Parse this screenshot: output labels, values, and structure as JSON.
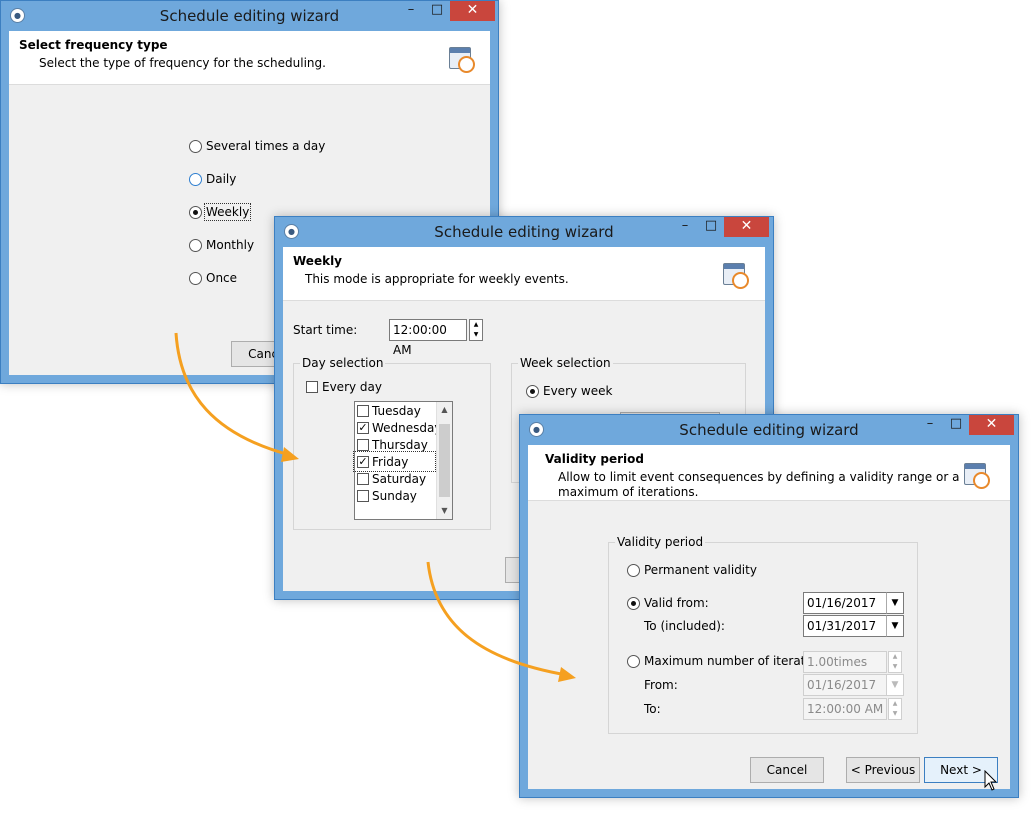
{
  "win1": {
    "title": "Schedule editing wizard",
    "header_title": "Select frequency type",
    "header_sub": "Select the type of frequency for the scheduling.",
    "options": [
      "Several times a day",
      "Daily",
      "Weekly",
      "Monthly",
      "Once"
    ],
    "selected": "Weekly",
    "cancel_label": "Cancel"
  },
  "win2": {
    "title": "Schedule editing wizard",
    "header_title": "Weekly",
    "header_sub": "This mode is appropriate for weekly events.",
    "start_time_label": "Start time:",
    "start_time_value": "12:00:00 AM",
    "day_selection_label": "Day selection",
    "every_day_label": "Every day",
    "days": [
      {
        "label": "Tuesday",
        "checked": false
      },
      {
        "label": "Wednesday",
        "checked": true
      },
      {
        "label": "Thursday",
        "checked": false
      },
      {
        "label": "Friday",
        "checked": true
      },
      {
        "label": "Saturday",
        "checked": false
      },
      {
        "label": "Sunday",
        "checked": false
      }
    ],
    "week_selection_label": "Week selection",
    "every_week_label": "Every week"
  },
  "win3": {
    "title": "Schedule editing wizard",
    "header_title": "Validity period",
    "header_sub_1": "Allow to limit event consequences by defining a validity range or a",
    "header_sub_2": "maximum of iterations.",
    "group_label": "Validity period",
    "permanent_label": "Permanent validity",
    "valid_from_label": "Valid from:",
    "valid_from_value": "01/16/2017",
    "to_included_label": "To (included):",
    "to_included_value": "01/31/2017",
    "max_iter_label": "Maximum number of iterations",
    "max_iter_value": "1.00times",
    "from_label": "From:",
    "from_value": "01/16/2017",
    "to_label": "To:",
    "to_value": "12:00:00 AM",
    "cancel_label": "Cancel",
    "previous_label": "< Previous",
    "next_label": "Next >"
  },
  "colors": {
    "titlebar": "#6fa8dc",
    "close": "#c9463d",
    "arrow": "#f5a020"
  },
  "icons": [
    "app-icon",
    "minimize-icon",
    "maximize-icon",
    "close-icon",
    "calendar-clock-icon",
    "mouse-cursor-icon"
  ]
}
